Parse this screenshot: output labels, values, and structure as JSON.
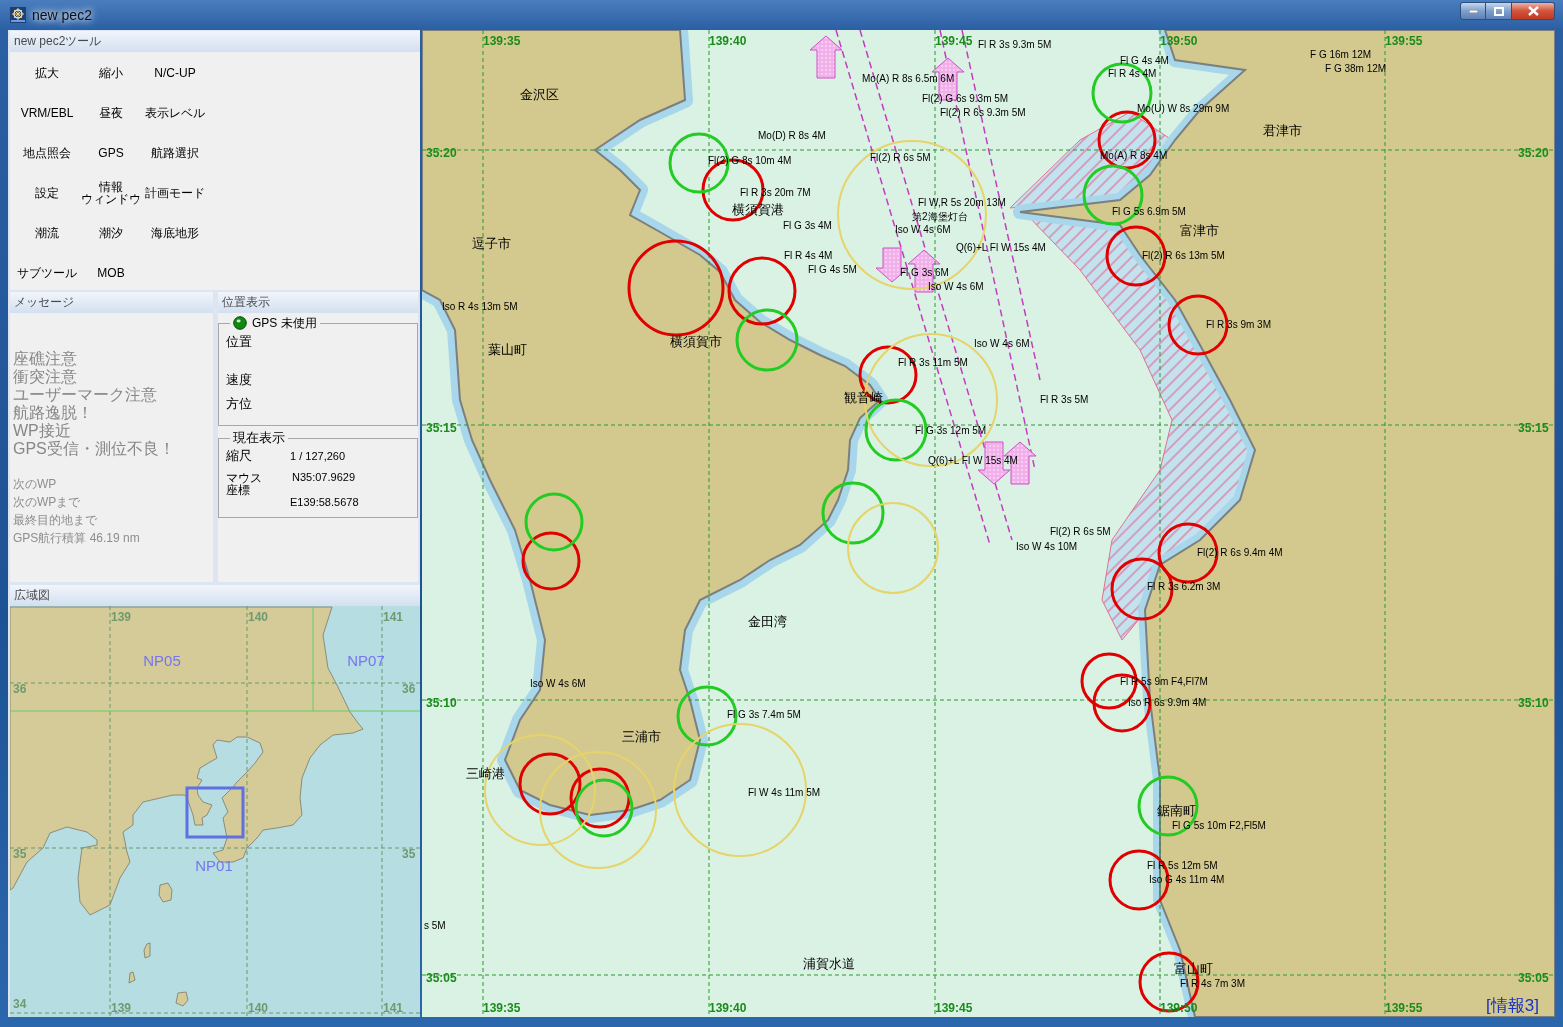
{
  "window": {
    "title": "new pec2"
  },
  "tool_panel": {
    "title": "new pec2ツール",
    "tools": [
      "拡大",
      "縮小",
      "N/C-UP",
      "VRM/EBL",
      "昼夜",
      "表示レベル",
      "地点照会",
      "GPS",
      "航路選択",
      "設定",
      "情報ウィンドウ",
      "計画モード",
      "潮流",
      "潮汐",
      "海底地形",
      "サブツール",
      "MOB"
    ]
  },
  "message_panel": {
    "title": "メッセージ",
    "alarms": [
      {
        "text": "座礁注意",
        "active": false
      },
      {
        "text": "衝突注意",
        "active": false
      },
      {
        "text": "ユーザーマーク注意",
        "active": false
      },
      {
        "text": "航路逸脱！",
        "active": false
      },
      {
        "text": "WP接近",
        "active": false
      },
      {
        "text": "GPS受信・測位不良！",
        "active": false
      }
    ],
    "info_lines": [
      "次のWP",
      "次のWPまで",
      "最終目的地まで",
      "GPS航行積算 46.19 nm"
    ]
  },
  "position_panel": {
    "title": "位置表示",
    "gps_group": {
      "title": "GPS 未使用",
      "fields": [
        "位置",
        "速度",
        "方位"
      ]
    },
    "view_group": {
      "title": "現在表示",
      "scale_label": "縮尺",
      "scale_value": "1 / 127,260",
      "mouse_label": "マウス座標",
      "latitude": "N35:07.9629",
      "longitude": "E139:58.5678"
    }
  },
  "overview_map": {
    "title": "広域図",
    "top_labels": [
      "139",
      "140",
      "141"
    ],
    "bottom_labels": [
      "139",
      "140",
      "141"
    ],
    "left_labels": [
      "36",
      "35",
      "34"
    ],
    "right_labels": [
      "36",
      "35"
    ],
    "chart_names": [
      "NP05",
      "NP07",
      "NP01"
    ]
  },
  "chart": {
    "top_labels": [
      "139:35",
      "139:40",
      "139:45",
      "139:50",
      "139:55"
    ],
    "bottom_labels": [
      "139:35",
      "139:40",
      "139:45",
      "139:50",
      "139:55"
    ],
    "left_labels": [
      "35:20",
      "35:15",
      "35:10",
      "35:05"
    ],
    "right_labels": [
      "35:20",
      "35:15",
      "35:10",
      "35:05"
    ],
    "place_names": [
      "金沢区",
      "逗子市",
      "横須賀港",
      "横須賀市",
      "葉山町",
      "観音崎",
      "金田湾",
      "三浦市",
      "三崎港",
      "浦賀水道",
      "君津市",
      "富津市",
      "鋸南町",
      "富山町"
    ],
    "light_labels": [
      "Fl R 3s 9.3m 5M",
      "Mo(A) R 8s 6.5m 6M",
      "Fl(2) G 6s 9.3m 5M",
      "Fl(2) R 6s 9.3m 5M",
      "Mo(D) R 8s 4M",
      "Fl(2) G 8s 10m 4M",
      "Fl(2) R 6s 5M",
      "Fl R 3s 20m 7M",
      "Fl W,R 5s 20m 13M",
      "第2海堡灯台",
      "Iso W 4s 6M",
      "Fl G 3s 4M",
      "Q(6)+L Fl W 15s 4M",
      "Fl R 4s 4M",
      "Fl G 4s 5M",
      "Fl G 3s 6M",
      "Iso W 4s 6M",
      "Iso R 4s 13m 5M",
      "Iso W 4s 6M",
      "Fl R 3s 11m 5M",
      "Fl R 3s 5M",
      "Fl G 3s 12m 5M",
      "Q(6)+L Fl W 15s 4M",
      "Fl(2) R 6s 5M",
      "Iso W 4s 10M",
      "Fl G 4s 4M",
      "Mo(U) W 8s 29m 9M",
      "Mo(A) R 8s 4M",
      "F G 16m 12M",
      "F G 38m 12M",
      "Fl G 5s 6.9m 5M",
      "Fl(2) R 6s 13m 5M",
      "Fl R 3s 9m 3M",
      "Fl(2) R 6s 9.4m 4M",
      "Fl R 3s 6.2m 3M",
      "Fl R 5s 9m F4,Fl7M",
      "Iso R 6s 9.9m 4M",
      "Fl G 5s 10m F2,Fl5M",
      "Fl R 5s 12m 5M",
      "Iso G 4s 11m 4M",
      "Fl R 4s 7m 3M",
      "Fl G 3s 7.4m 5M",
      "Fl W 4s 11m 5M",
      "Iso W 4s 6M",
      "Fl R 4s 4M",
      "s 5M"
    ],
    "info_tag": "[情報3]"
  }
}
